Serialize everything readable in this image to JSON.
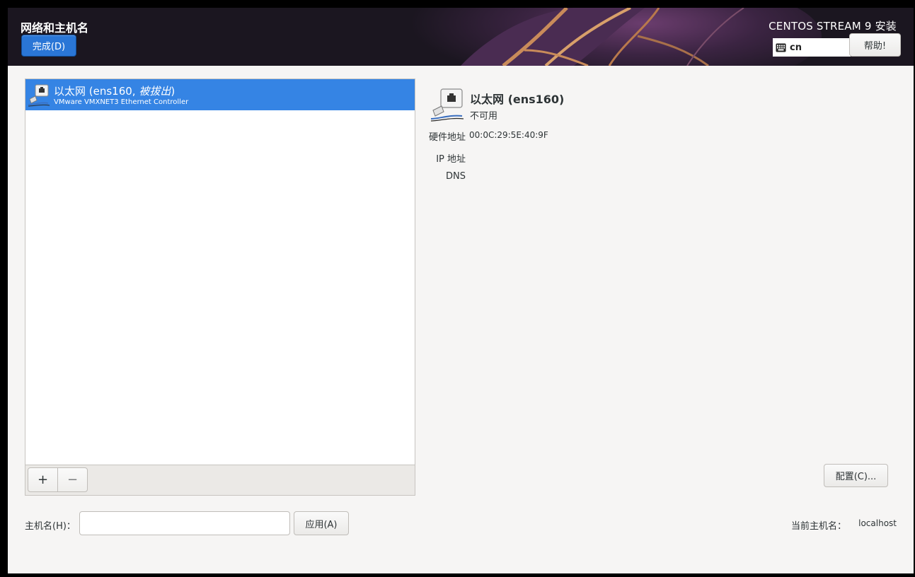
{
  "header": {
    "spoke_title": "网络和主机名",
    "done_label": "完成(D)",
    "product_title": "CENTOS STREAM 9 安装",
    "keyboard_layout": "cn",
    "help_label": "帮助!"
  },
  "devices": [
    {
      "name": "以太网 (ens160, ",
      "state": "被拔出",
      "name_suffix": ")",
      "description": "VMware VMXNET3 Ethernet Controller",
      "selected": true
    }
  ],
  "list_toolbar": {
    "add_label": "+",
    "remove_label": "−"
  },
  "details": {
    "name": "以太网 (ens160)",
    "status": "不可用",
    "hardware_address_label": "硬件地址",
    "hardware_address": "00:0C:29:5E:40:9F",
    "ip_address_label": "IP 地址",
    "ip_address": "",
    "dns_label": "DNS",
    "dns": "",
    "configure_label": "配置(C)..."
  },
  "hostname": {
    "label": "主机名(H)：",
    "value": "",
    "placeholder": "",
    "apply_label": "应用(A)",
    "current_label": "当前主机名：",
    "current_value": "localhost"
  },
  "colors": {
    "accent": "#3584e4",
    "done_button": "#2a76d6",
    "header_bg": "#1b1620",
    "window_bg": "#f6f5f4"
  },
  "icons": {
    "keyboard": "keyboard-icon",
    "ethernet": "ethernet-icon"
  }
}
